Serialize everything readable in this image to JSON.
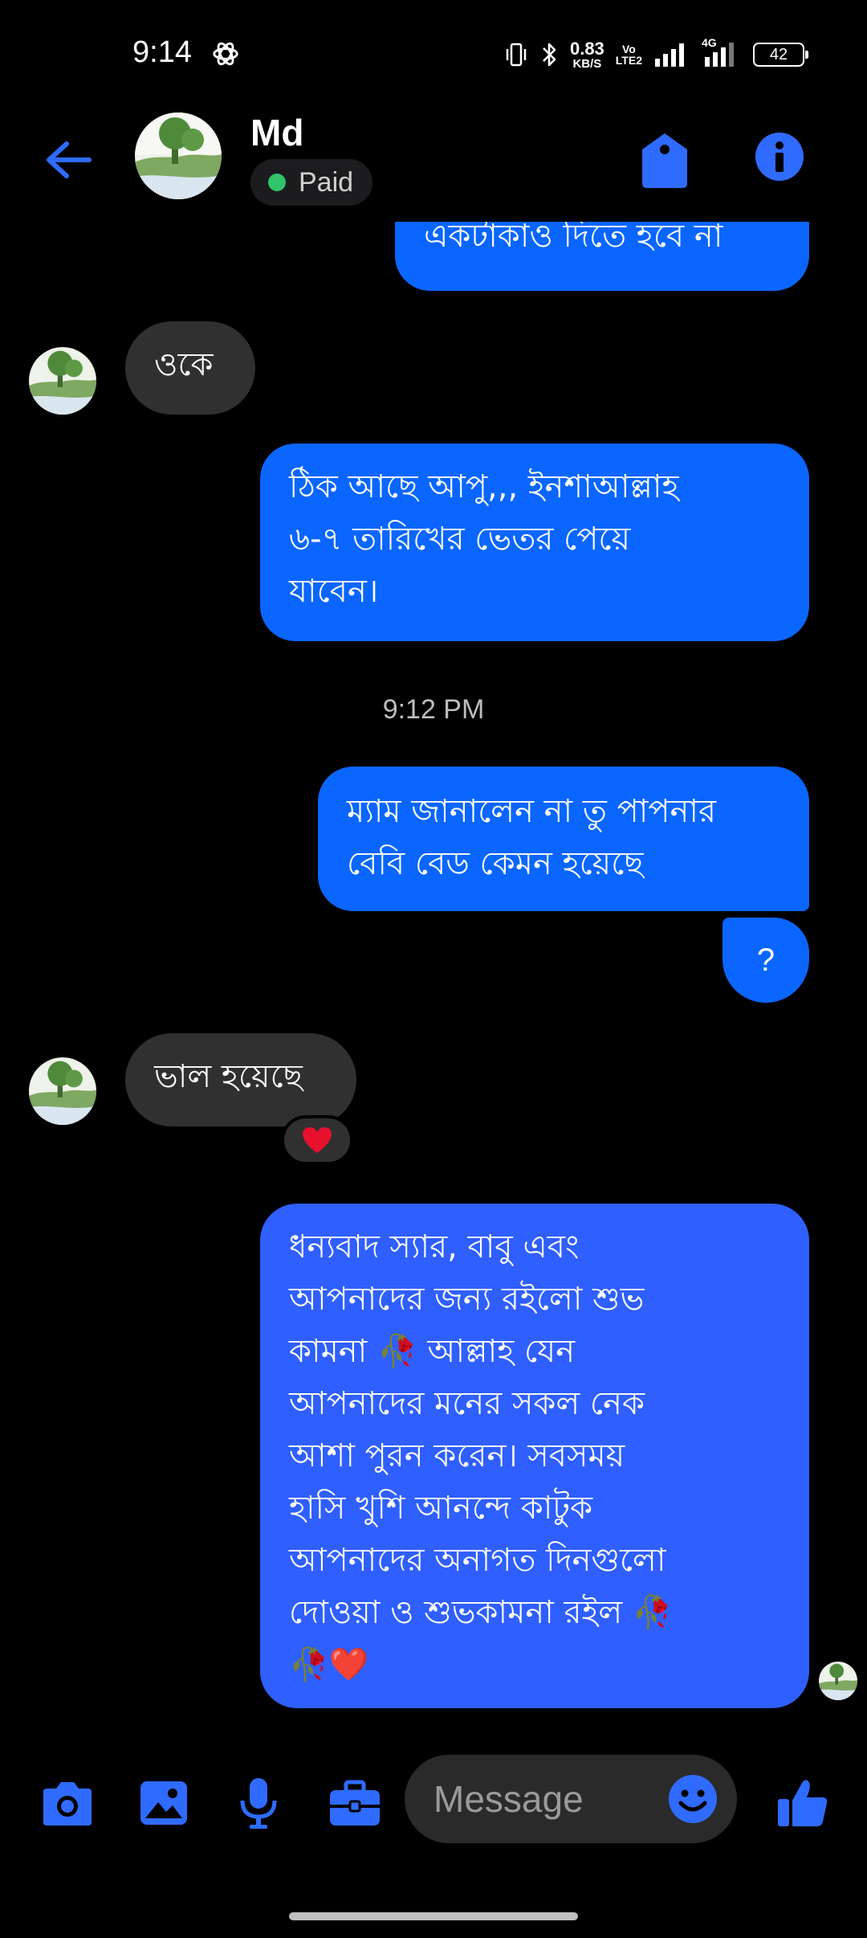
{
  "status_bar": {
    "time": "9:14",
    "net_speed_value": "0.83",
    "net_speed_unit": "KB/S",
    "volte_top": "Vo",
    "volte_bottom": "LTE2",
    "network_type": "4G",
    "battery": "42",
    "icons": [
      "chatgpt-icon",
      "vibrate-icon",
      "bluetooth-icon",
      "signal-icon"
    ]
  },
  "header": {
    "contact_name": "Md",
    "label": "Paid",
    "label_color": "#31c46a",
    "icons": [
      "back-arrow-icon",
      "tag-icon",
      "info-icon"
    ]
  },
  "messages": [
    {
      "id": "m1",
      "direction": "outgoing",
      "text": "একটাকাও দিতে হবে না"
    },
    {
      "id": "m2",
      "direction": "incoming",
      "text": "ওকে"
    },
    {
      "id": "m3",
      "direction": "outgoing",
      "lines": [
        "ঠিক আছে আপু,,, ইনশাআল্লাহ",
        "৬-৭ তারিখের ভেতর পেয়ে",
        "যাবেন।"
      ]
    },
    {
      "id": "t1",
      "type": "timestamp",
      "text": "9:12 PM"
    },
    {
      "id": "m4",
      "direction": "outgoing",
      "lines": [
        "ম্যাম জানালেন না তু পাপনার",
        "বেবি বেড কেমন হয়েছে"
      ]
    },
    {
      "id": "m5",
      "direction": "outgoing",
      "text": "?"
    },
    {
      "id": "m6",
      "direction": "incoming",
      "text": "ভাল হয়েছে",
      "reaction": "❤️"
    },
    {
      "id": "m7",
      "direction": "outgoing",
      "lines": [
        "ধন্যবাদ স্যার, বাবু এবং",
        "আপনাদের জন্য রইলো শুভ",
        "কামনা 🥀 আল্লাহ যেন",
        "আপনাদের মনের সকল নেক",
        "আশা পুরন করেন। সবসময়",
        "হাসি খুশি আনন্দে কাটুক",
        "আপনাদের অনাগত দিনগুলো",
        "দোওয়া ও শুভকামনা রইল 🥀",
        "🥀❤️"
      ]
    }
  ],
  "composer": {
    "placeholder": "Message",
    "icons": [
      "camera-icon",
      "image-icon",
      "mic-icon",
      "briefcase-icon",
      "emoji-icon",
      "thumbs-up-icon"
    ]
  },
  "colors": {
    "background": "#000000",
    "outgoing_bubble": "#0a66ff",
    "incoming_bubble": "#303030",
    "accent": "#2f6bff"
  }
}
